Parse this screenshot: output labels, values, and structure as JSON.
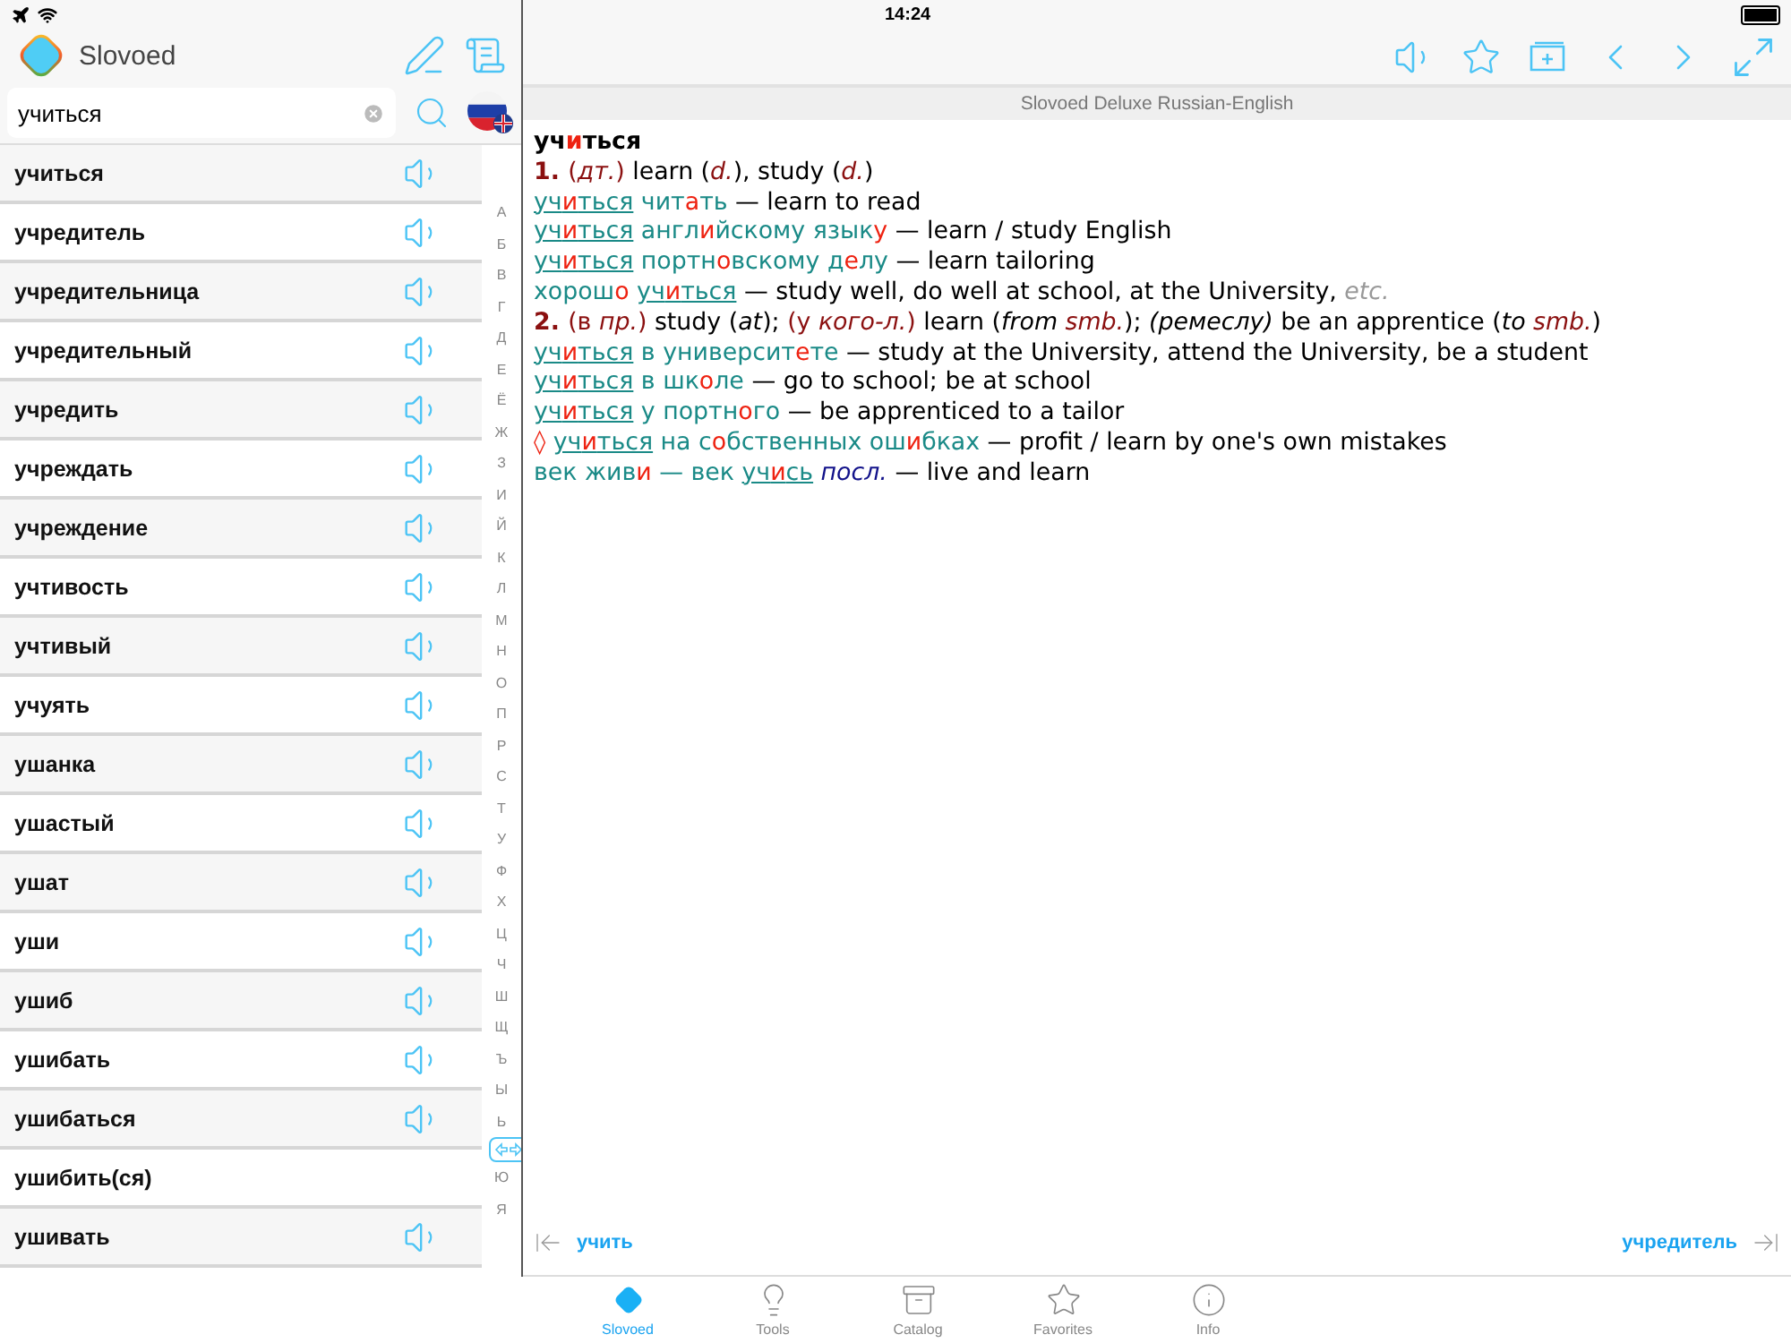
{
  "status_bar": {
    "time": "14:24"
  },
  "app": {
    "name": "Slovoed"
  },
  "search": {
    "value": "учиться"
  },
  "words": [
    {
      "text": "учиться",
      "audio": true
    },
    {
      "text": "учредитель",
      "audio": true
    },
    {
      "text": "учредительница",
      "audio": true
    },
    {
      "text": "учредительный",
      "audio": true
    },
    {
      "text": "учредить",
      "audio": true
    },
    {
      "text": "учреждать",
      "audio": true
    },
    {
      "text": "учреждение",
      "audio": true
    },
    {
      "text": "учтивость",
      "audio": true
    },
    {
      "text": "учтивый",
      "audio": true
    },
    {
      "text": "учуять",
      "audio": true
    },
    {
      "text": "ушанка",
      "audio": true
    },
    {
      "text": "ушастый",
      "audio": true
    },
    {
      "text": "ушат",
      "audio": true
    },
    {
      "text": "уши",
      "audio": true
    },
    {
      "text": "ушиб",
      "audio": true
    },
    {
      "text": "ушибать",
      "audio": true
    },
    {
      "text": "ушибаться",
      "audio": true
    },
    {
      "text": "ушибить(ся)",
      "audio": false
    },
    {
      "text": "ушивать",
      "audio": true
    }
  ],
  "alphabet": [
    "А",
    "Б",
    "В",
    "Г",
    "Д",
    "Е",
    "Ё",
    "Ж",
    "З",
    "И",
    "Й",
    "К",
    "Л",
    "М",
    "Н",
    "О",
    "П",
    "Р",
    "С",
    "Т",
    "У",
    "Ф",
    "Х",
    "Ц",
    "Ч",
    "Ш",
    "Щ",
    "Ъ",
    "Ы",
    "Ь",
    "Ю",
    "Я"
  ],
  "dictionary_title": "Slovoed Deluxe Russian-English",
  "entry": [
    {
      "parts": [
        {
          "kind": "head",
          "text": "уч"
        },
        {
          "kind": "head_stress",
          "text": "и"
        },
        {
          "kind": "head",
          "text": "ться"
        }
      ]
    },
    {
      "parts": [
        {
          "kind": "num",
          "text": "1. "
        },
        {
          "kind": "label",
          "text": "("
        },
        {
          "kind": "label_italic",
          "text": "дт."
        },
        {
          "kind": "label",
          "text": ")"
        },
        {
          "kind": "plain",
          "text": " learn ("
        },
        {
          "kind": "label_italic",
          "text": "d."
        },
        {
          "kind": "plain",
          "text": "), study ("
        },
        {
          "kind": "label_italic",
          "text": "d."
        },
        {
          "kind": "plain",
          "text": ")"
        }
      ]
    },
    {
      "parts": [
        {
          "kind": "link",
          "parts": [
            {
              "kind": "ex",
              "text": "уч"
            },
            {
              "kind": "stress",
              "text": "и"
            },
            {
              "kind": "ex",
              "text": "ться"
            }
          ]
        },
        {
          "kind": "ex",
          "text": " чит"
        },
        {
          "kind": "stress",
          "text": "а"
        },
        {
          "kind": "ex",
          "text": "ть"
        },
        {
          "kind": "plain",
          "text": " — learn to read"
        }
      ]
    },
    {
      "parts": [
        {
          "kind": "link",
          "parts": [
            {
              "kind": "ex",
              "text": "уч"
            },
            {
              "kind": "stress",
              "text": "и"
            },
            {
              "kind": "ex",
              "text": "ться"
            }
          ]
        },
        {
          "kind": "ex",
          "text": " англ"
        },
        {
          "kind": "stress",
          "text": "и"
        },
        {
          "kind": "ex",
          "text": "йскому язык"
        },
        {
          "kind": "stress",
          "text": "у"
        },
        {
          "kind": "plain",
          "text": " — learn / study English"
        }
      ]
    },
    {
      "parts": [
        {
          "kind": "link",
          "parts": [
            {
              "kind": "ex",
              "text": "уч"
            },
            {
              "kind": "stress",
              "text": "и"
            },
            {
              "kind": "ex",
              "text": "ться"
            }
          ]
        },
        {
          "kind": "ex",
          "text": " портн"
        },
        {
          "kind": "stress",
          "text": "о"
        },
        {
          "kind": "ex",
          "text": "вскому д"
        },
        {
          "kind": "stress",
          "text": "е"
        },
        {
          "kind": "ex",
          "text": "лу"
        },
        {
          "kind": "plain",
          "text": " — learn tailoring"
        }
      ]
    },
    {
      "parts": [
        {
          "kind": "ex",
          "text": "хорош"
        },
        {
          "kind": "stress",
          "text": "о "
        },
        {
          "kind": "link",
          "parts": [
            {
              "kind": "ex",
              "text": "уч"
            },
            {
              "kind": "stress",
              "text": "и"
            },
            {
              "kind": "ex",
              "text": "ться"
            }
          ]
        },
        {
          "kind": "plain",
          "text": " — study well, do well at school, at the University, "
        },
        {
          "kind": "note",
          "text": "etc."
        }
      ]
    },
    {
      "parts": [
        {
          "kind": "num",
          "text": "2. "
        },
        {
          "kind": "label",
          "text": "(в "
        },
        {
          "kind": "label_italic",
          "text": "пр."
        },
        {
          "kind": "label",
          "text": ")"
        },
        {
          "kind": "plain",
          "text": " study ("
        },
        {
          "kind": "italic",
          "text": "at"
        },
        {
          "kind": "plain",
          "text": "); "
        },
        {
          "kind": "label",
          "text": "(у "
        },
        {
          "kind": "label_italic",
          "text": "кого-л."
        },
        {
          "kind": "label",
          "text": ")"
        },
        {
          "kind": "plain",
          "text": " learn ("
        },
        {
          "kind": "italic",
          "text": "from "
        },
        {
          "kind": "label_italic",
          "text": "smb."
        },
        {
          "kind": "plain",
          "text": "); "
        },
        {
          "kind": "italic",
          "text": "(ремеслу)"
        },
        {
          "kind": "plain",
          "text": " be an apprentice ("
        },
        {
          "kind": "italic",
          "text": "to "
        },
        {
          "kind": "label_italic",
          "text": "smb."
        },
        {
          "kind": "plain",
          "text": ")"
        }
      ]
    },
    {
      "parts": [
        {
          "kind": "link",
          "parts": [
            {
              "kind": "ex",
              "text": "уч"
            },
            {
              "kind": "stress",
              "text": "и"
            },
            {
              "kind": "ex",
              "text": "ться"
            }
          ]
        },
        {
          "kind": "ex",
          "text": " в университ"
        },
        {
          "kind": "stress",
          "text": "е"
        },
        {
          "kind": "ex",
          "text": "те"
        },
        {
          "kind": "plain",
          "text": " — study at the University, attend the University, be a student"
        }
      ]
    },
    {
      "parts": [
        {
          "kind": "link",
          "parts": [
            {
              "kind": "ex",
              "text": "уч"
            },
            {
              "kind": "stress",
              "text": "и"
            },
            {
              "kind": "ex",
              "text": "ться"
            }
          ]
        },
        {
          "kind": "ex",
          "text": " в шк"
        },
        {
          "kind": "stress",
          "text": "о"
        },
        {
          "kind": "ex",
          "text": "ле"
        },
        {
          "kind": "plain",
          "text": " — go to school; be at school"
        }
      ]
    },
    {
      "parts": [
        {
          "kind": "link",
          "parts": [
            {
              "kind": "ex",
              "text": "уч"
            },
            {
              "kind": "stress",
              "text": "и"
            },
            {
              "kind": "ex",
              "text": "ться"
            }
          ]
        },
        {
          "kind": "ex",
          "text": " у портн"
        },
        {
          "kind": "stress",
          "text": "о"
        },
        {
          "kind": "ex",
          "text": "го"
        },
        {
          "kind": "plain",
          "text": " — be apprenticed to a tailor"
        }
      ]
    },
    {
      "parts": [
        {
          "kind": "stress",
          "text": "◊ "
        },
        {
          "kind": "link",
          "parts": [
            {
              "kind": "ex",
              "text": "уч"
            },
            {
              "kind": "stress",
              "text": "и"
            },
            {
              "kind": "ex",
              "text": "ться"
            }
          ]
        },
        {
          "kind": "ex",
          "text": " на с"
        },
        {
          "kind": "stress",
          "text": "о"
        },
        {
          "kind": "ex",
          "text": "бственных ош"
        },
        {
          "kind": "stress",
          "text": "и"
        },
        {
          "kind": "ex",
          "text": "бках"
        },
        {
          "kind": "plain",
          "text": " — profit / learn by one's own mistakes"
        }
      ]
    },
    {
      "parts": [
        {
          "kind": "ex",
          "text": "век жив"
        },
        {
          "kind": "stress",
          "text": "и"
        },
        {
          "kind": "ex",
          "text": " — век "
        },
        {
          "kind": "link",
          "parts": [
            {
              "kind": "ex",
              "text": "уч"
            },
            {
              "kind": "stress",
              "text": "и"
            },
            {
              "kind": "ex",
              "text": "сь"
            }
          ]
        },
        {
          "kind": "abbr",
          "text": " посл."
        },
        {
          "kind": "plain",
          "text": " — live and learn"
        }
      ]
    }
  ],
  "nav": {
    "previous": "учить",
    "next": "учредитель"
  },
  "tabs": [
    {
      "label": "Slovoed",
      "kind": "logo",
      "selected": true
    },
    {
      "label": "Tools",
      "kind": "bulb",
      "selected": false
    },
    {
      "label": "Catalog",
      "kind": "drawer",
      "selected": false
    },
    {
      "label": "Favorites",
      "kind": "star",
      "selected": false
    },
    {
      "label": "Info",
      "kind": "info",
      "selected": false
    }
  ]
}
